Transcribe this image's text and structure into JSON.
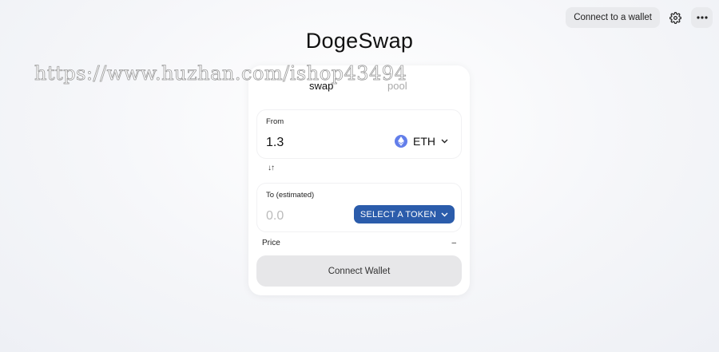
{
  "header": {
    "connect_label": "Connect to a wallet",
    "settings_icon": "gear-icon",
    "menu_icon": "more-horizontal-icon"
  },
  "app": {
    "title": "DogeSwap"
  },
  "watermark": {
    "text": "https://www.huzhan.com/ishop43494"
  },
  "tabs": [
    {
      "label": "swap",
      "active": true
    },
    {
      "label": "pool",
      "active": false
    }
  ],
  "from": {
    "label": "From",
    "amount": "1.3",
    "token": "ETH"
  },
  "switch_icon": "↓↑",
  "to": {
    "label": "To (estimated)",
    "placeholder": "0.0",
    "select_label": "SELECT A TOKEN"
  },
  "price": {
    "label": "Price",
    "value": "–"
  },
  "connect_wallet_label": "Connect Wallet",
  "colors": {
    "accent": "#2b5cab",
    "eth": "#627eea"
  }
}
